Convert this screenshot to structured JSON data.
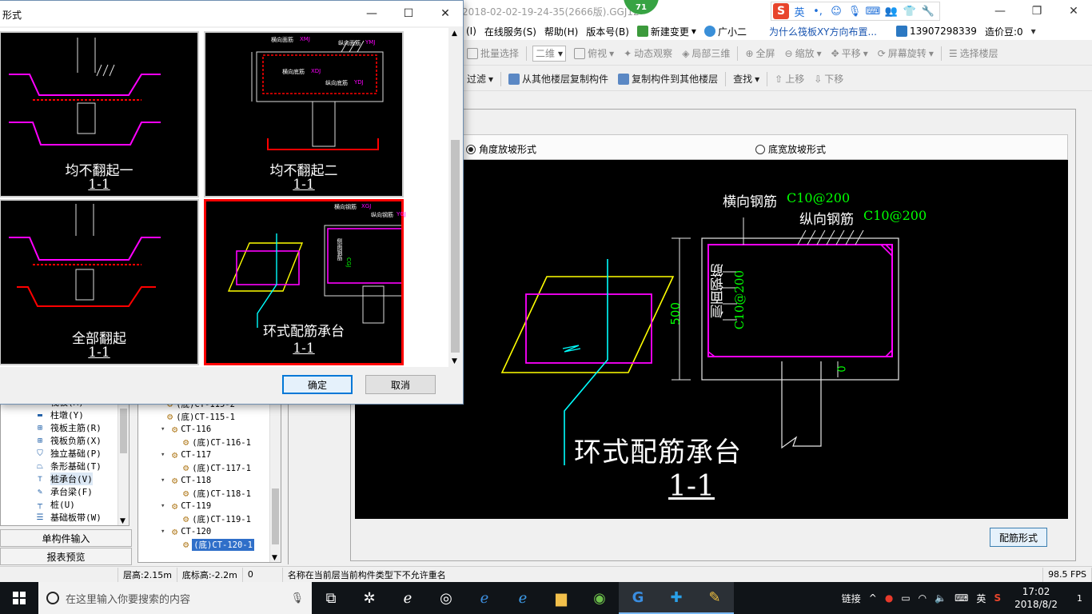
{
  "app": {
    "title": "2018-02-02-19-24-35(2666版).GGJ12",
    "notification_count": "71"
  },
  "ime_toolbar": {
    "logo": "S",
    "lang": "英",
    "icons": [
      "punctuation-icon",
      "emoji-icon",
      "mic-icon",
      "keyboard-icon",
      "users-icon",
      "shirt-icon",
      "wrench-icon"
    ]
  },
  "menubar": {
    "items": [
      "(I)",
      "在线服务(S)",
      "帮助(H)",
      "版本号(B)",
      "新建变更",
      "广小二"
    ],
    "question": "为什么筏板XY方向布置...",
    "phone": "13907298339",
    "bean": "造价豆:0"
  },
  "toolbar1": {
    "batch_select": "批量选择",
    "view_mode": "二维",
    "top_view": "俯视",
    "dynamic_view": "动态观察",
    "local_3d": "局部三维",
    "fullscreen": "全屏",
    "zoom": "缩放",
    "pan": "平移",
    "rotate": "屏幕旋转",
    "select_floor": "选择楼层"
  },
  "toolbar2": {
    "filter": "过滤",
    "copy_from": "从其他楼层复制构件",
    "copy_to": "复制构件到其他楼层",
    "find": "查找",
    "move_up": "上移",
    "move_down": "下移"
  },
  "form": {
    "radio_angle": "角度放坡形式",
    "radio_width": "底宽放坡形式",
    "rebar_form_button": "配筋形式",
    "preview": {
      "transverse_label": "横向钢筋",
      "transverse_value": "C10@200",
      "longitudinal_label": "纵向钢筋",
      "longitudinal_value": "C10@200",
      "side_label": "侧面钢筋",
      "side_value": "C10@200",
      "height_dim": "500",
      "bottom_dim": "0",
      "title": "环式配筋承台",
      "section": "1-1"
    }
  },
  "left_tree": {
    "items": [
      {
        "label": "筏板(M)",
        "icon": "raft-icon"
      },
      {
        "label": "柱墩(Y)",
        "icon": "pier-icon"
      },
      {
        "label": "筏板主筋(R)",
        "icon": "grid-icon"
      },
      {
        "label": "筏板负筋(X)",
        "icon": "grid-icon"
      },
      {
        "label": "独立基础(P)",
        "icon": "footing-icon"
      },
      {
        "label": "条形基础(T)",
        "icon": "strip-icon"
      },
      {
        "label": "桩承台(V)",
        "icon": "pilecap-icon"
      },
      {
        "label": "承台梁(F)",
        "icon": "beam-icon"
      },
      {
        "label": "桩(U)",
        "icon": "pile-icon"
      },
      {
        "label": "基础板带(W)",
        "icon": "band-icon"
      }
    ],
    "buttons": [
      "单构件输入",
      "报表预览"
    ]
  },
  "mid_tree": {
    "rows": [
      {
        "label": "(底)CT-115-2",
        "level": 2
      },
      {
        "label": "(底)CT-115-1",
        "level": 2
      },
      {
        "label": "CT-116",
        "level": 1
      },
      {
        "label": "(底)CT-116-1",
        "level": 2
      },
      {
        "label": "CT-117",
        "level": 1
      },
      {
        "label": "(底)CT-117-1",
        "level": 2
      },
      {
        "label": "CT-118",
        "level": 1
      },
      {
        "label": "(底)CT-118-1",
        "level": 2
      },
      {
        "label": "CT-119",
        "level": 1
      },
      {
        "label": "(底)CT-119-1",
        "level": 2
      },
      {
        "label": "CT-120",
        "level": 1
      },
      {
        "label": "(底)CT-120-1",
        "level": 2,
        "selected": true
      }
    ]
  },
  "statusbar": {
    "floor_height": "层高:2.15m",
    "bottom_elev": "底标高:-2.2m",
    "zero": "0",
    "message": "名称在当前层当前构件类型下不允许重名",
    "fps": "98.5 FPS"
  },
  "dialog": {
    "title": "形式",
    "ok": "确定",
    "cancel": "取消",
    "options": [
      {
        "title": "均不翻起一",
        "section": "1-1"
      },
      {
        "title": "均不翻起二",
        "section": "1-1"
      },
      {
        "title": "全部翻起",
        "section": "1-1"
      },
      {
        "title": "环式配筋承台",
        "section": "1-1",
        "selected": true
      }
    ],
    "labels": {
      "top_rebar": "横向面筋",
      "top_rebar_code": "XMJ",
      "long_top_rebar": "纵向面筋",
      "long_top_rebar_code": "YMJ",
      "bottom_rebar": "横向底筋",
      "bottom_rebar_code": "XDJ",
      "long_bottom_rebar": "纵向底筋",
      "long_bottom_rebar_code": "YDJ",
      "trans_rebar": "横向钢筋",
      "trans_rebar_code": "XGJ",
      "long_rebar": "纵向钢筋",
      "long_rebar_code": "YGJ",
      "side_rebar": "侧面钢筋",
      "side_rebar_code": "CGJ"
    }
  },
  "taskbar": {
    "search_placeholder": "在这里输入你要搜索的内容",
    "ime": "英",
    "link": "链接",
    "time": "17:02",
    "date": "2018/8/2",
    "notification": "1"
  },
  "colors": {
    "accent_blue": "#0078d7",
    "selection_red": "#ff0000",
    "rebar_magenta": "#ff00ff",
    "rebar_green": "#00ff00",
    "pile_cyan": "#00ffff",
    "plane_yellow": "#ffff00"
  }
}
